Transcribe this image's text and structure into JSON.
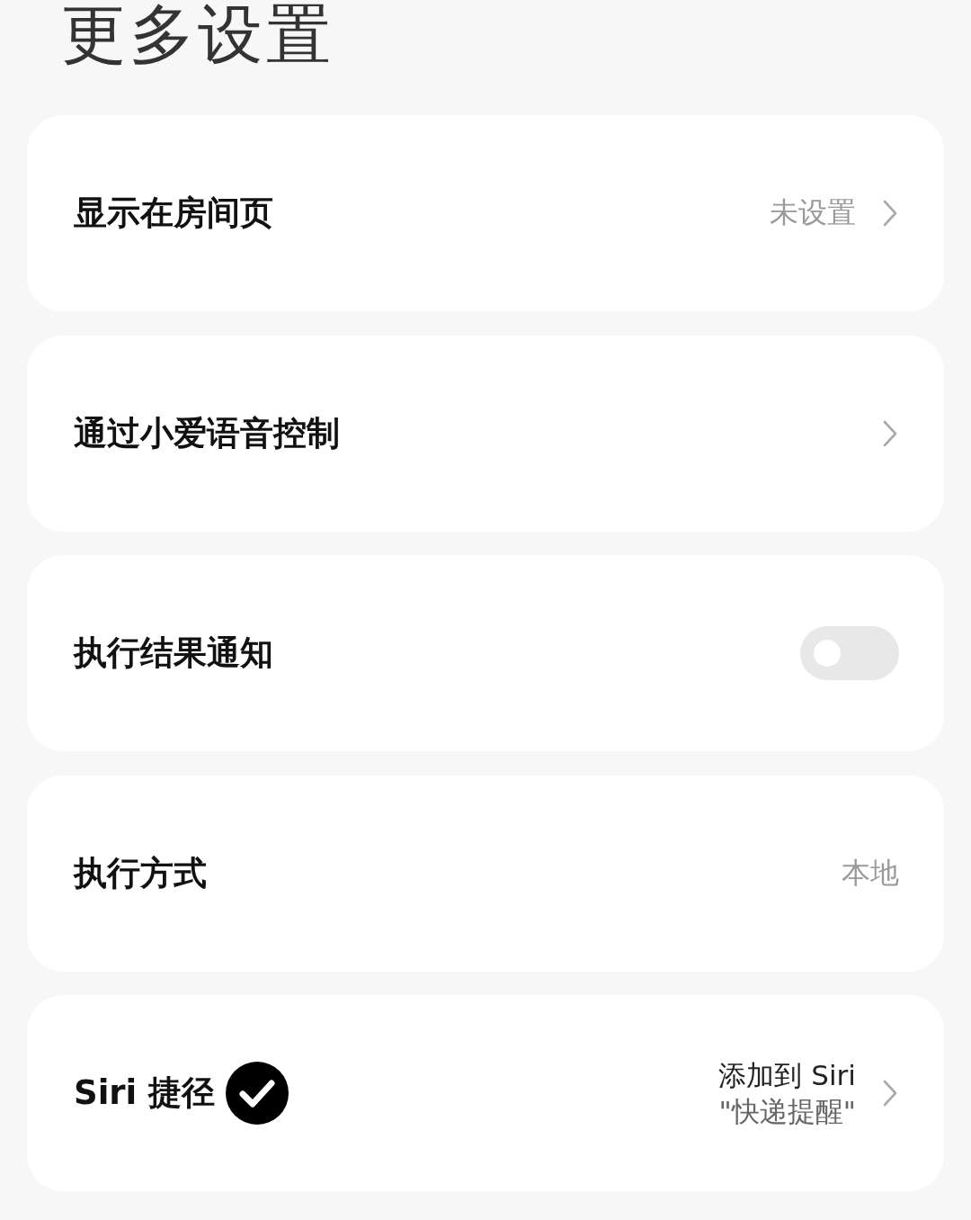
{
  "title": "更多设置",
  "items": [
    {
      "kind": "link",
      "label": "显示在房间页",
      "value": "未设置"
    },
    {
      "kind": "link",
      "label": "通过小爱语音控制"
    },
    {
      "kind": "toggle",
      "label": "执行结果通知",
      "on": false
    },
    {
      "kind": "value",
      "label": "执行方式",
      "value": "本地"
    },
    {
      "kind": "shortcut",
      "label": "Siri 捷径",
      "action": "添加到 Siri",
      "phrase": "\"快递提醒\""
    }
  ]
}
